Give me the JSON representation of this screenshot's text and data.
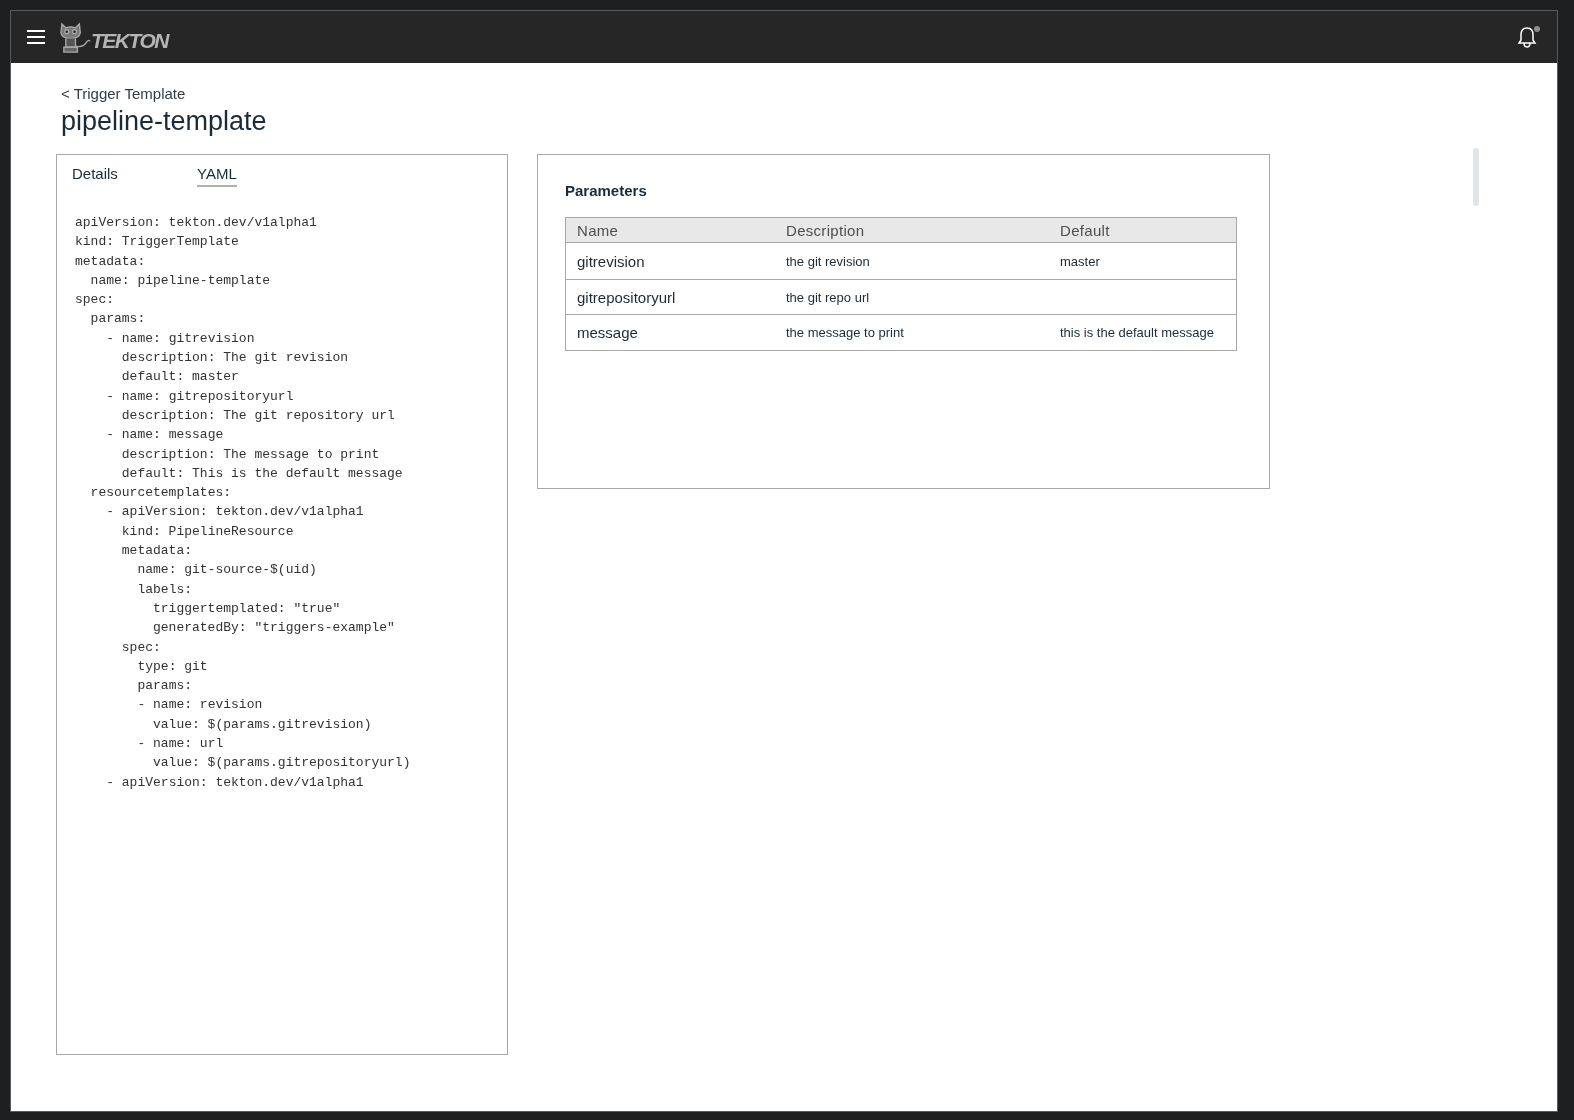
{
  "header": {
    "logo_text": "TEKTON",
    "notifications": {
      "unread": true
    }
  },
  "breadcrumb": "< Trigger Template",
  "title": "pipeline-template",
  "tabs": [
    {
      "label": "Details",
      "selected": false
    },
    {
      "label": "YAML",
      "selected": true
    }
  ],
  "yaml": [
    "apiVersion: tekton.dev/v1alpha1",
    "kind: TriggerTemplate",
    "metadata:",
    "  name: pipeline-template",
    "spec:",
    "  params:",
    "    - name: gitrevision",
    "      description: The git revision",
    "      default: master",
    "    - name: gitrepositoryurl",
    "      description: The git repository url",
    "    - name: message",
    "      description: The message to print",
    "      default: This is the default message",
    "  resourcetemplates:",
    "    - apiVersion: tekton.dev/v1alpha1",
    "      kind: PipelineResource",
    "      metadata:",
    "        name: git-source-$(uid)",
    "        labels:",
    "          triggertemplated: \"true\"",
    "          generatedBy: \"triggers-example\"",
    "      spec:",
    "        type: git",
    "        params:",
    "        - name: revision",
    "          value: $(params.gitrevision)",
    "        - name: url",
    "          value: $(params.gitrepositoryurl)",
    "    - apiVersion: tekton.dev/v1alpha1"
  ],
  "parameters": {
    "title": "Parameters",
    "columns": [
      "Name",
      "Description",
      "Default"
    ],
    "rows": [
      {
        "name": "gitrevision",
        "description": "the git revision",
        "default": "master"
      },
      {
        "name": "gitrepositoryurl",
        "description": "the git repo url"
      },
      {
        "name": "message",
        "description": "the message to print",
        "default": "this is the default message"
      }
    ]
  }
}
